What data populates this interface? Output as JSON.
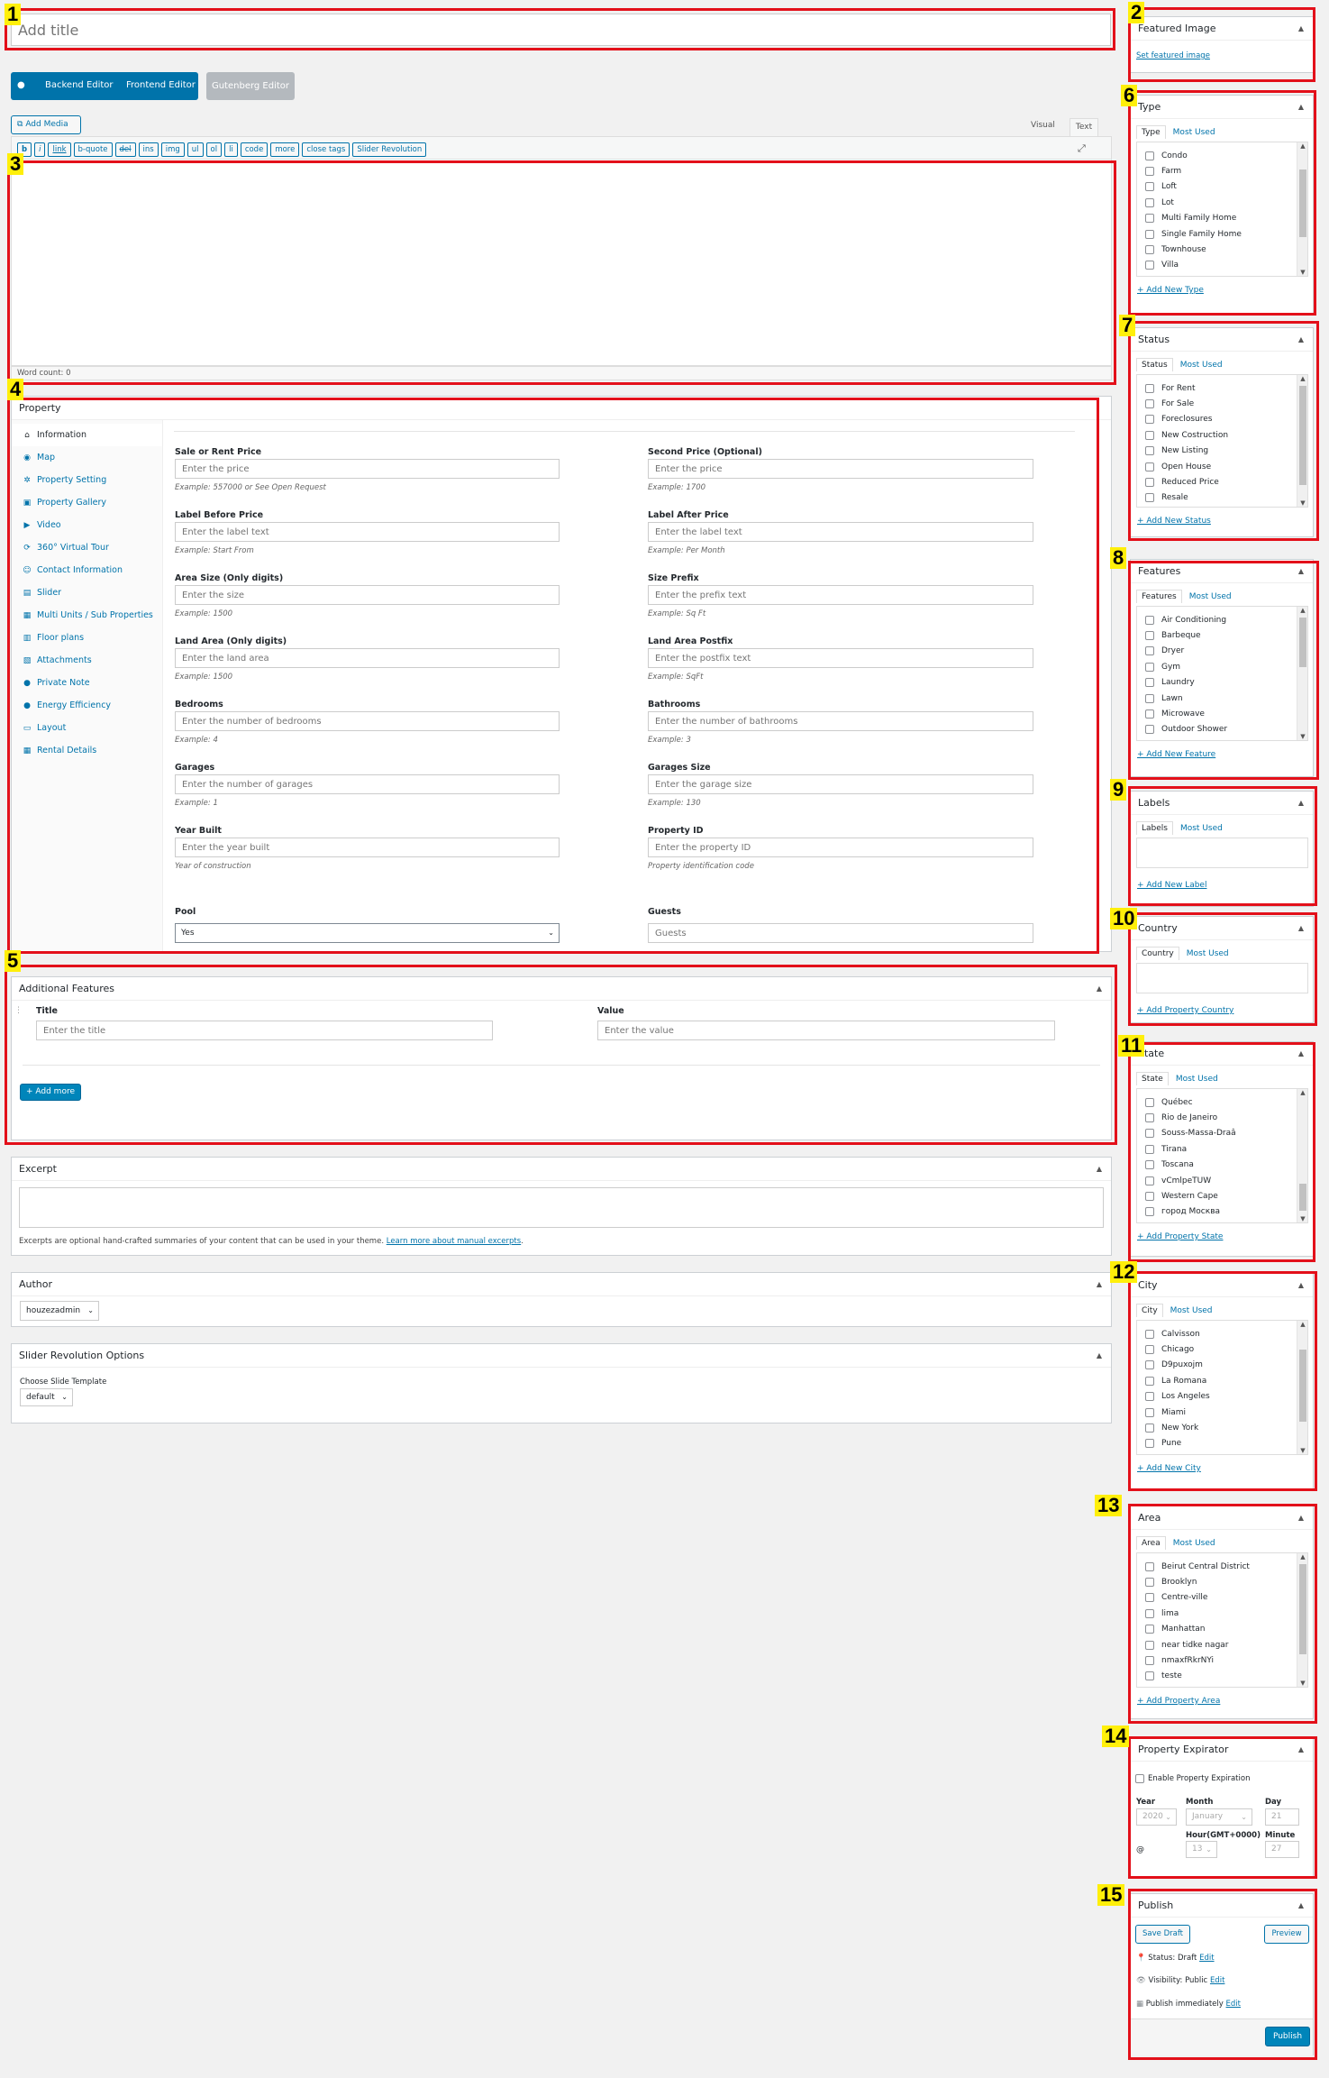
{
  "title_field": {
    "placeholder": "Add title"
  },
  "editor_mode": {
    "backend": "Backend Editor",
    "frontend": "Frontend Editor",
    "gutenberg": "Gutenberg Editor"
  },
  "editor": {
    "add_media": "Add Media",
    "tab_visual": "Visual",
    "tab_text": "Text",
    "quicktags": [
      "b",
      "i",
      "link",
      "b-quote",
      "del",
      "ins",
      "img",
      "ul",
      "ol",
      "li",
      "code",
      "more",
      "close tags",
      "Slider Revolution"
    ],
    "word_count": "Word count: 0"
  },
  "property": {
    "title": "Property",
    "nav": [
      {
        "label": "Information",
        "icon": "home-icon"
      },
      {
        "label": "Map",
        "icon": "map-pin-icon"
      },
      {
        "label": "Property Setting",
        "icon": "gear-icon"
      },
      {
        "label": "Property Gallery",
        "icon": "gallery-icon"
      },
      {
        "label": "Video",
        "icon": "video-icon"
      },
      {
        "label": "360° Virtual Tour",
        "icon": "tour-icon"
      },
      {
        "label": "Contact Information",
        "icon": "contact-icon"
      },
      {
        "label": "Slider",
        "icon": "slider-icon"
      },
      {
        "label": "Multi Units / Sub Properties",
        "icon": "units-icon"
      },
      {
        "label": "Floor plans",
        "icon": "floorplan-icon"
      },
      {
        "label": "Attachments",
        "icon": "attachment-icon"
      },
      {
        "label": "Private Note",
        "icon": "pin-icon"
      },
      {
        "label": "Energy Efficiency",
        "icon": "bulb-icon"
      },
      {
        "label": "Layout",
        "icon": "layout-icon"
      },
      {
        "label": "Rental Details",
        "icon": "rental-icon"
      }
    ],
    "fields_left": [
      {
        "label": "Sale or Rent Price",
        "placeholder": "Enter the price",
        "hint": "Example: 557000 or See Open Request"
      },
      {
        "label": "Label Before Price",
        "placeholder": "Enter the label text",
        "hint": "Example: Start From"
      },
      {
        "label": "Area Size (Only digits)",
        "placeholder": "Enter the size",
        "hint": "Example: 1500"
      },
      {
        "label": "Land Area (Only digits)",
        "placeholder": "Enter the land area",
        "hint": "Example: 1500"
      },
      {
        "label": "Bedrooms",
        "placeholder": "Enter the number of bedrooms",
        "hint": "Example: 4"
      },
      {
        "label": "Garages",
        "placeholder": "Enter the number of garages",
        "hint": "Example: 1"
      },
      {
        "label": "Year Built",
        "placeholder": "Enter the year built",
        "hint": "Year of construction"
      }
    ],
    "fields_right": [
      {
        "label": "Second Price (Optional)",
        "placeholder": "Enter the price",
        "hint": "Example: 1700"
      },
      {
        "label": "Label After Price",
        "placeholder": "Enter the label text",
        "hint": "Example: Per Month"
      },
      {
        "label": "Size Prefix",
        "placeholder": "Enter the prefix text",
        "hint": "Example: Sq Ft"
      },
      {
        "label": "Land Area Postfix",
        "placeholder": "Enter the postfix text",
        "hint": "Example: SqFt"
      },
      {
        "label": "Bathrooms",
        "placeholder": "Enter the number of bathrooms",
        "hint": "Example: 3"
      },
      {
        "label": "Garages Size",
        "placeholder": "Enter the garage size",
        "hint": "Example: 130"
      },
      {
        "label": "Property ID",
        "placeholder": "Enter the property ID",
        "hint": "Property identification code"
      }
    ],
    "pool": {
      "label": "Pool",
      "value": "Yes"
    },
    "guests": {
      "label": "Guests",
      "placeholder": "Guests"
    }
  },
  "additional_features": {
    "title": "Additional Features",
    "col_title": "Title",
    "col_value": "Value",
    "title_placeholder": "Enter the title",
    "value_placeholder": "Enter the value",
    "add_more": "+ Add more"
  },
  "excerpt": {
    "title": "Excerpt",
    "help": "Excerpts are optional hand-crafted summaries of your content that can be used in your theme.",
    "help_link": "Learn more about manual excerpts",
    "help_end": "."
  },
  "author": {
    "title": "Author",
    "value": "houzezadmin"
  },
  "slider_rev": {
    "title": "Slider Revolution Options",
    "label": "Choose Slide Template",
    "value": "default"
  },
  "featured_image": {
    "title": "Featured Image",
    "link": "Set featured image"
  },
  "taxonomies": [
    {
      "key": "type",
      "title": "Type",
      "tab_all": "Type",
      "tab_used": "Most Used",
      "items": [
        "Condo",
        "Farm",
        "Loft",
        "Lot",
        "Multi Family Home",
        "Single Family Home",
        "Townhouse",
        "Villa"
      ],
      "add": "+ Add New Type"
    },
    {
      "key": "status",
      "title": "Status",
      "tab_all": "Status",
      "tab_used": "Most Used",
      "items": [
        "For Rent",
        "For Sale",
        "Foreclosures",
        "New Costruction",
        "New Listing",
        "Open House",
        "Reduced Price",
        "Resale"
      ],
      "add": "+ Add New Status"
    },
    {
      "key": "features",
      "title": "Features",
      "tab_all": "Features",
      "tab_used": "Most Used",
      "items": [
        "Air Conditioning",
        "Barbeque",
        "Dryer",
        "Gym",
        "Laundry",
        "Lawn",
        "Microwave",
        "Outdoor Shower"
      ],
      "add": "+ Add New Feature"
    },
    {
      "key": "labels",
      "title": "Labels",
      "tab_all": "Labels",
      "tab_used": "Most Used",
      "items": [],
      "add": "+ Add New Label"
    },
    {
      "key": "country",
      "title": "Country",
      "tab_all": "Country",
      "tab_used": "Most Used",
      "items": [],
      "add": "+ Add Property Country"
    },
    {
      "key": "state",
      "title": "State",
      "tab_all": "State",
      "tab_used": "Most Used",
      "items": [
        "Québec",
        "Rio de Janeiro",
        "Souss-Massa-Draâ",
        "Tirana",
        "Toscana",
        "vCmlpeTUW",
        "Western Cape",
        "город Москва"
      ],
      "add": "+ Add Property State"
    },
    {
      "key": "city",
      "title": "City",
      "tab_all": "City",
      "tab_used": "Most Used",
      "items": [
        "Calvisson",
        "Chicago",
        "D9puxojm",
        "La Romana",
        "Los Angeles",
        "Miami",
        "New York",
        "Pune"
      ],
      "add": "+ Add New City"
    },
    {
      "key": "area",
      "title": "Area",
      "tab_all": "Area",
      "tab_used": "Most Used",
      "items": [
        "Beirut Central District",
        "Brooklyn",
        "Centre-ville",
        "lima",
        "Manhattan",
        "near tidke nagar",
        "nmaxfRkrNYi",
        "teste"
      ],
      "add": "+ Add Property Area"
    }
  ],
  "expirator": {
    "title": "Property Expirator",
    "enable": "Enable Property Expiration",
    "year_label": "Year",
    "year": "2020",
    "month_label": "Month",
    "month": "January",
    "day_label": "Day",
    "day": "21",
    "hour_label": "Hour(GMT+0000)",
    "hour": "13",
    "minute_label": "Minute",
    "minute": "27",
    "at": "@"
  },
  "publish": {
    "title": "Publish",
    "save_draft": "Save Draft",
    "preview": "Preview",
    "status_label": "Status:",
    "status": "Draft",
    "edit": "Edit",
    "visibility_label": "Visibility:",
    "visibility": "Public",
    "schedule": "Publish immediately",
    "publish_btn": "Publish"
  },
  "annotations": [
    "1",
    "2",
    "3",
    "4",
    "5",
    "6",
    "7",
    "8",
    "9",
    "10",
    "11",
    "12",
    "13",
    "14",
    "15"
  ],
  "colors": {
    "annotation_border": "#e3101a",
    "annotation_bg": "#ffef0a",
    "wp_blue": "#0073aa",
    "primary_button": "#0085ba"
  }
}
